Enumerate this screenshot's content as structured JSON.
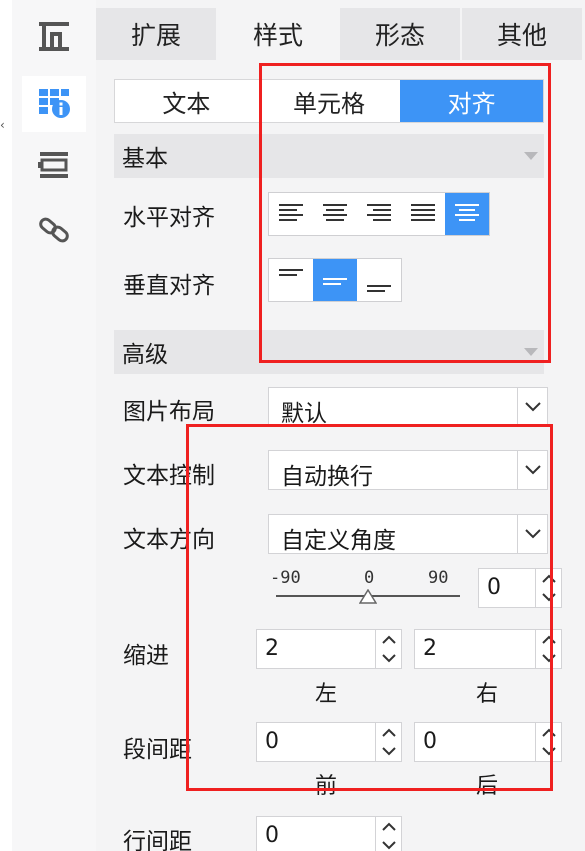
{
  "sidebar": {
    "items": [
      {
        "icon": "layout-icon",
        "active": false
      },
      {
        "icon": "cell-info-icon",
        "active": true
      },
      {
        "icon": "widget-icon",
        "active": false
      },
      {
        "icon": "link-icon",
        "active": false
      }
    ]
  },
  "tabs": [
    "扩展",
    "样式",
    "形态",
    "其他"
  ],
  "active_tab": "样式",
  "segment": {
    "items": [
      "文本",
      "单元格",
      "对齐"
    ],
    "active": "对齐"
  },
  "basic": {
    "title": "基本",
    "h_align_label": "水平对齐",
    "h_align_options": [
      "align-left-icon",
      "align-center-icon",
      "align-right-icon",
      "align-justify-icon",
      "align-distributed-icon"
    ],
    "h_align_selected": "align-distributed-icon",
    "v_align_label": "垂直对齐",
    "v_align_options": [
      "valign-top-icon",
      "valign-middle-icon",
      "valign-bottom-icon"
    ],
    "v_align_selected": "valign-middle-icon"
  },
  "advanced": {
    "title": "高级",
    "image_layout_label": "图片布局",
    "image_layout_value": "默认",
    "text_control_label": "文本控制",
    "text_control_value": "自动换行",
    "text_direction_label": "文本方向",
    "text_direction_value": "自定义角度",
    "rotation": {
      "min": "-90",
      "mid": "0",
      "max": "90",
      "value": "0",
      "level": 0.5
    },
    "indent_label": "缩进",
    "indent_left_value": "2",
    "indent_right_value": "2",
    "left_label": "左",
    "right_label": "右",
    "para_spacing_label": "段间距",
    "para_before_value": "0",
    "para_after_value": "0",
    "before_label": "前",
    "after_label": "后",
    "line_spacing_label": "行间距",
    "line_spacing_value": "0"
  },
  "colors": {
    "accent": "#3d94f6",
    "highlight_box": "#ef2020"
  }
}
